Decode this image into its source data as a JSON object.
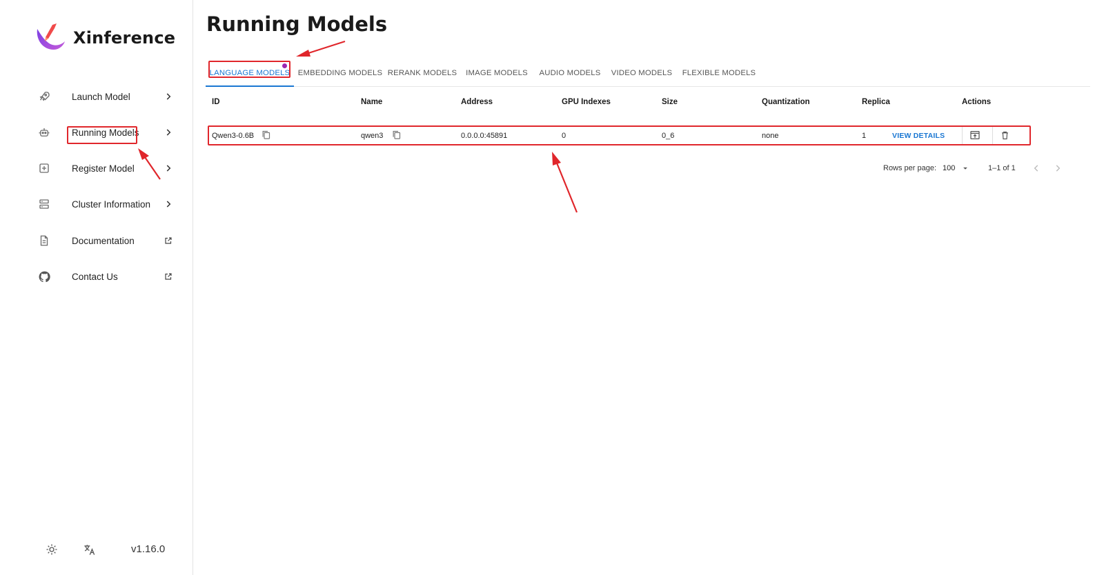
{
  "app": {
    "name": "Xinference",
    "version": "v1.16.0"
  },
  "sidebar": {
    "items": [
      {
        "label": "Launch Model",
        "icon": "rocket-icon",
        "trailing": "chevron-right-icon"
      },
      {
        "label": "Running Models",
        "icon": "robot-icon",
        "trailing": "chevron-right-icon"
      },
      {
        "label": "Register Model",
        "icon": "add-box-icon",
        "trailing": "chevron-right-icon"
      },
      {
        "label": "Cluster Information",
        "icon": "storage-icon",
        "trailing": "chevron-right-icon"
      },
      {
        "label": "Documentation",
        "icon": "document-icon",
        "trailing": "open-in-new-icon"
      },
      {
        "label": "Contact Us",
        "icon": "github-icon",
        "trailing": "open-in-new-icon"
      }
    ],
    "footer": {
      "theme_icon": "sun-icon",
      "language_icon": "translate-icon"
    }
  },
  "main": {
    "title": "Running Models",
    "tabs": [
      {
        "label": "LANGUAGE MODELS",
        "active": true
      },
      {
        "label": "EMBEDDING MODELS",
        "active": false
      },
      {
        "label": "RERANK MODELS",
        "active": false
      },
      {
        "label": "IMAGE MODELS",
        "active": false
      },
      {
        "label": "AUDIO MODELS",
        "active": false
      },
      {
        "label": "VIDEO MODELS",
        "active": false
      },
      {
        "label": "FLEXIBLE MODELS",
        "active": false
      }
    ],
    "table": {
      "columns": [
        "ID",
        "Name",
        "Address",
        "GPU Indexes",
        "Size",
        "Quantization",
        "Replica",
        "Actions"
      ],
      "rows": [
        {
          "id": "Qwen3-0.6B",
          "name": "qwen3",
          "address": "0.0.0.0:45891",
          "gpu_indexes": "0",
          "size": "0_6",
          "quantization": "none",
          "replica": "1",
          "view_details": "VIEW DETAILS"
        }
      ]
    },
    "pagination": {
      "rows_per_page_label": "Rows per page:",
      "rows_per_page": "100",
      "range": "1–1 of 1"
    }
  },
  "colors": {
    "accent": "#1976d2",
    "annotation": "#e0262b",
    "badge": "#9c27b0"
  }
}
